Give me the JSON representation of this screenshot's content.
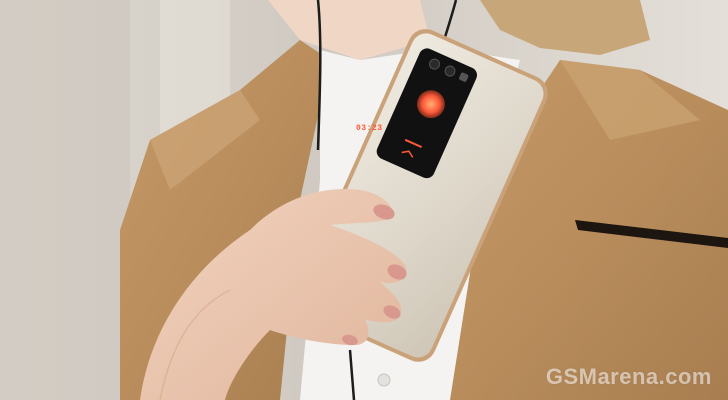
{
  "photo": {
    "subject": "woman-holding-smartphone",
    "colors": {
      "background": "#d9d4cc",
      "coat": "#b98d5c",
      "shirt": "#f4f3f1",
      "phone_body": "#e3ddd1",
      "phone_trim": "#caa27a",
      "skin": "#e9c7b1",
      "nails": "#d9988e",
      "cover_display": "#111111",
      "accent_orange": "#ff5a3c"
    }
  },
  "cover_display": {
    "time": "03:23"
  },
  "watermark": {
    "text": "GSMarena.com"
  }
}
